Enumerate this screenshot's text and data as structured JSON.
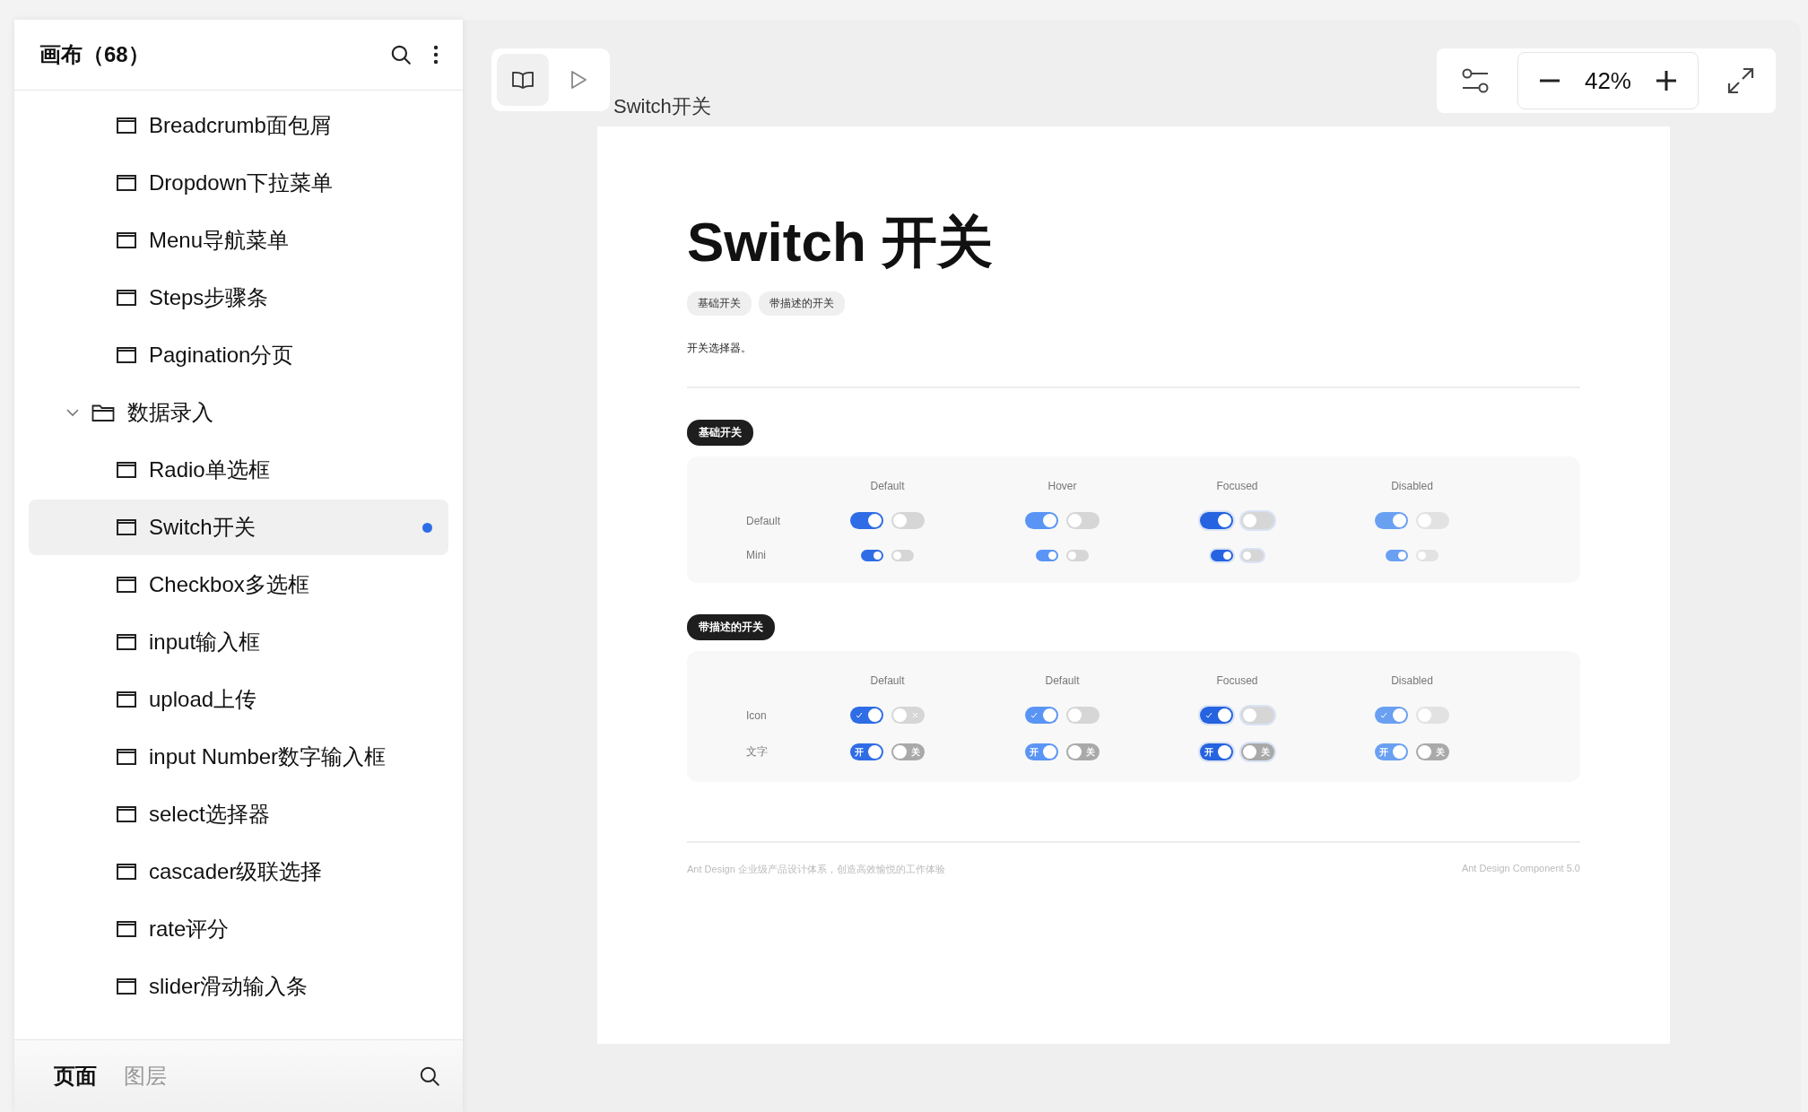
{
  "sidebar": {
    "title": "画布（68）",
    "tree": [
      {
        "kind": "page",
        "label": "Breadcrumb面包屑",
        "selected": false
      },
      {
        "kind": "page",
        "label": "Dropdown下拉菜单",
        "selected": false
      },
      {
        "kind": "page",
        "label": "Menu导航菜单",
        "selected": false
      },
      {
        "kind": "page",
        "label": "Steps步骤条",
        "selected": false
      },
      {
        "kind": "page",
        "label": "Pagination分页",
        "selected": false
      },
      {
        "kind": "folder",
        "label": "数据录入",
        "selected": false,
        "expanded": true,
        "children": [
          {
            "kind": "page",
            "label": "Radio单选框",
            "selected": false
          },
          {
            "kind": "page",
            "label": "Switch开关",
            "selected": true
          },
          {
            "kind": "page",
            "label": "Checkbox多选框",
            "selected": false
          },
          {
            "kind": "page",
            "label": "input输入框",
            "selected": false
          },
          {
            "kind": "page",
            "label": "upload上传",
            "selected": false
          },
          {
            "kind": "page",
            "label": "input Number数字输入框",
            "selected": false
          },
          {
            "kind": "page",
            "label": "select选择器",
            "selected": false
          },
          {
            "kind": "page",
            "label": "cascader级联选择",
            "selected": false
          },
          {
            "kind": "page",
            "label": "rate评分",
            "selected": false
          },
          {
            "kind": "page",
            "label": "slider滑动输入条",
            "selected": false
          }
        ]
      }
    ],
    "tabs": [
      {
        "label": "页面",
        "selected": true
      },
      {
        "label": "图层",
        "selected": false
      }
    ]
  },
  "toolbar": {
    "modes": [
      {
        "kind": "book",
        "selected": true
      },
      {
        "kind": "play",
        "selected": false
      }
    ],
    "zoom": "42%"
  },
  "canvas": {
    "frame_label": "Switch开关",
    "page": {
      "title": "Switch 开关",
      "tags": [
        "基础开关",
        "带描述的开关"
      ],
      "description": "开关选择器。",
      "sections": [
        {
          "heading": "基础开关",
          "columns": [
            {
              "label": "Default",
              "kind": "default"
            },
            {
              "label": "Hover",
              "kind": "hover"
            },
            {
              "label": "Focused",
              "kind": "focused"
            },
            {
              "label": "Disabled",
              "kind": "disabled"
            }
          ],
          "rows": [
            {
              "label": "Default",
              "kind": "default",
              "cells": [
                [
                  {
                    "on": true,
                    "kind": "plain"
                  },
                  {
                    "on": false,
                    "kind": "plain"
                  }
                ],
                [
                  {
                    "on": true,
                    "kind": "plain"
                  },
                  {
                    "on": false,
                    "kind": "plain"
                  }
                ],
                [
                  {
                    "on": true,
                    "kind": "plain"
                  },
                  {
                    "on": false,
                    "kind": "plain"
                  }
                ],
                [
                  {
                    "on": true,
                    "kind": "plain"
                  },
                  {
                    "on": false,
                    "kind": "plain"
                  }
                ]
              ]
            },
            {
              "label": "Mini",
              "kind": "mini",
              "cells": [
                [
                  {
                    "on": true,
                    "kind": "plain"
                  },
                  {
                    "on": false,
                    "kind": "plain"
                  }
                ],
                [
                  {
                    "on": true,
                    "kind": "plain"
                  },
                  {
                    "on": false,
                    "kind": "plain"
                  }
                ],
                [
                  {
                    "on": true,
                    "kind": "plain"
                  },
                  {
                    "on": false,
                    "kind": "plain"
                  }
                ],
                [
                  {
                    "on": true,
                    "kind": "plain"
                  },
                  {
                    "on": false,
                    "kind": "plain"
                  }
                ]
              ]
            }
          ]
        },
        {
          "heading": "带描述的开关",
          "columns": [
            {
              "label": "Default",
              "kind": "default"
            },
            {
              "label": "Default",
              "kind": "hover"
            },
            {
              "label": "Focused",
              "kind": "focused"
            },
            {
              "label": "Disabled",
              "kind": "disabled"
            }
          ],
          "rows": [
            {
              "label": "Icon",
              "kind": "default",
              "cells": [
                [
                  {
                    "on": true,
                    "kind": "check"
                  },
                  {
                    "on": false,
                    "kind": "cross"
                  }
                ],
                [
                  {
                    "on": true,
                    "kind": "check"
                  },
                  {
                    "on": false,
                    "kind": "plain"
                  }
                ],
                [
                  {
                    "on": true,
                    "kind": "check"
                  },
                  {
                    "on": false,
                    "kind": "plain"
                  }
                ],
                [
                  {
                    "on": true,
                    "kind": "check"
                  },
                  {
                    "on": false,
                    "kind": "plain"
                  }
                ]
              ]
            },
            {
              "label": "文字",
              "kind": "default",
              "cells": [
                [
                  {
                    "on": true,
                    "kind": "text",
                    "text": "开"
                  },
                  {
                    "on": false,
                    "kind": "text",
                    "text": "关"
                  }
                ],
                [
                  {
                    "on": true,
                    "kind": "text",
                    "text": "开"
                  },
                  {
                    "on": false,
                    "kind": "text",
                    "text": "关"
                  }
                ],
                [
                  {
                    "on": true,
                    "kind": "text",
                    "text": "开"
                  },
                  {
                    "on": false,
                    "kind": "text",
                    "text": "关"
                  }
                ],
                [
                  {
                    "on": true,
                    "kind": "text",
                    "text": "开"
                  },
                  {
                    "on": false,
                    "kind": "text",
                    "text": "关"
                  }
                ]
              ]
            }
          ]
        }
      ],
      "footer_left": "Ant Design 企业级产品设计体系，创造高效愉悦的工作体验",
      "footer_right": "Ant Design Component 5.0"
    }
  }
}
